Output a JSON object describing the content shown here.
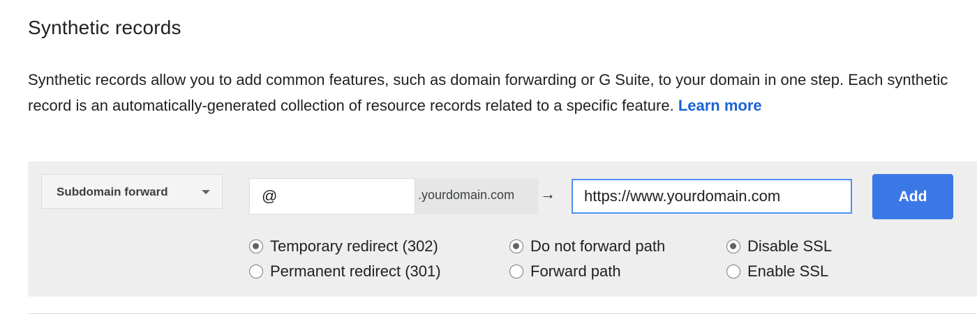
{
  "section": {
    "title": "Synthetic records",
    "description": "Synthetic records allow you to add common features, such as domain forwarding or G Suite, to your domain in one step. Each synthetic record is an automatically-generated collection of resource records related to a specific feature.",
    "learn_more": "Learn more"
  },
  "form": {
    "record_type": "Subdomain forward",
    "subdomain_value": "@",
    "domain_suffix": ".yourdomain.com",
    "arrow": "→",
    "destination_value": "https://www.yourdomain.com",
    "add_label": "Add"
  },
  "options": {
    "redirect": [
      {
        "label": "Temporary redirect (302)",
        "checked": true
      },
      {
        "label": "Permanent redirect (301)",
        "checked": false
      }
    ],
    "path": [
      {
        "label": "Do not forward path",
        "checked": true
      },
      {
        "label": "Forward path",
        "checked": false
      }
    ],
    "ssl": [
      {
        "label": "Disable SSL",
        "checked": true
      },
      {
        "label": "Enable SSL",
        "checked": false
      }
    ]
  },
  "colors": {
    "accent": "#3b78e7",
    "link": "#1a62d6",
    "panel": "#eeeeee"
  }
}
